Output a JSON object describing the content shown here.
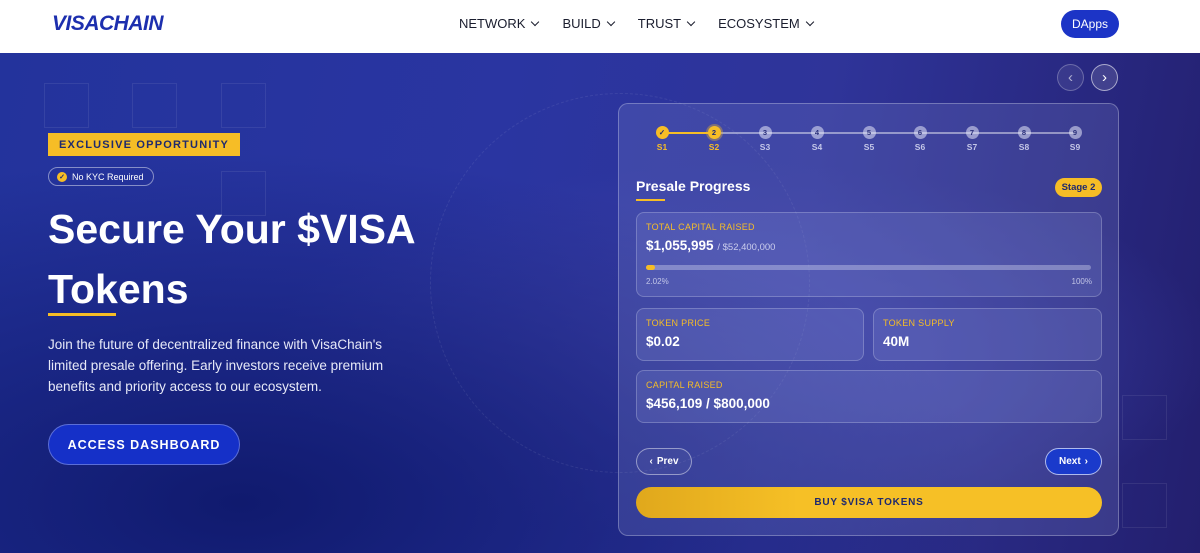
{
  "brand": {
    "logo": "VISACHAIN"
  },
  "nav": {
    "items": [
      {
        "label": "NETWORK"
      },
      {
        "label": "BUILD"
      },
      {
        "label": "TRUST"
      },
      {
        "label": "ECOSYSTEM"
      }
    ],
    "dapps_label": "DApps"
  },
  "hero": {
    "badge": "EXCLUSIVE OPPORTUNITY",
    "kyc": "No KYC Required",
    "headline_line1": "Secure Your $VISA",
    "headline_line2": "Tokens",
    "subtext": "Join the future of decentralized finance with VisaChain's limited presale offering. Early investors receive premium benefits and priority access to our ecosystem.",
    "cta": "ACCESS DASHBOARD"
  },
  "carousel": {
    "prev_icon": "chevron-left-icon",
    "next_icon": "chevron-right-icon"
  },
  "presale": {
    "steps": [
      {
        "num": "✓",
        "label": "S1",
        "state": "done"
      },
      {
        "num": "2",
        "label": "S2",
        "state": "active"
      },
      {
        "num": "3",
        "label": "S3",
        "state": "todo"
      },
      {
        "num": "4",
        "label": "S4",
        "state": "todo"
      },
      {
        "num": "5",
        "label": "S5",
        "state": "todo"
      },
      {
        "num": "6",
        "label": "S6",
        "state": "todo"
      },
      {
        "num": "7",
        "label": "S7",
        "state": "todo"
      },
      {
        "num": "8",
        "label": "S8",
        "state": "todo"
      },
      {
        "num": "9",
        "label": "S9",
        "state": "todo"
      }
    ],
    "title": "Presale Progress",
    "stage_badge": "Stage 2",
    "total": {
      "label": "TOTAL CAPITAL RAISED",
      "value": "$1,055,995",
      "target": "/ $52,400,000",
      "progress_percent": 2.02,
      "min_label": "2.02%",
      "max_label": "100%"
    },
    "token_price": {
      "label": "TOKEN PRICE",
      "value": "$0.02"
    },
    "token_supply": {
      "label": "TOKEN SUPPLY",
      "value": "40M"
    },
    "capital_raised": {
      "label": "CAPITAL RAISED",
      "value": "$456,109 / $800,000"
    },
    "prev_label": "Prev",
    "next_label": "Next",
    "buy_label": "BUY $VISA TOKENS"
  },
  "colors": {
    "accent": "#f6bd26",
    "primary": "#1c34c6",
    "hero_bg": "#2a35a1"
  }
}
